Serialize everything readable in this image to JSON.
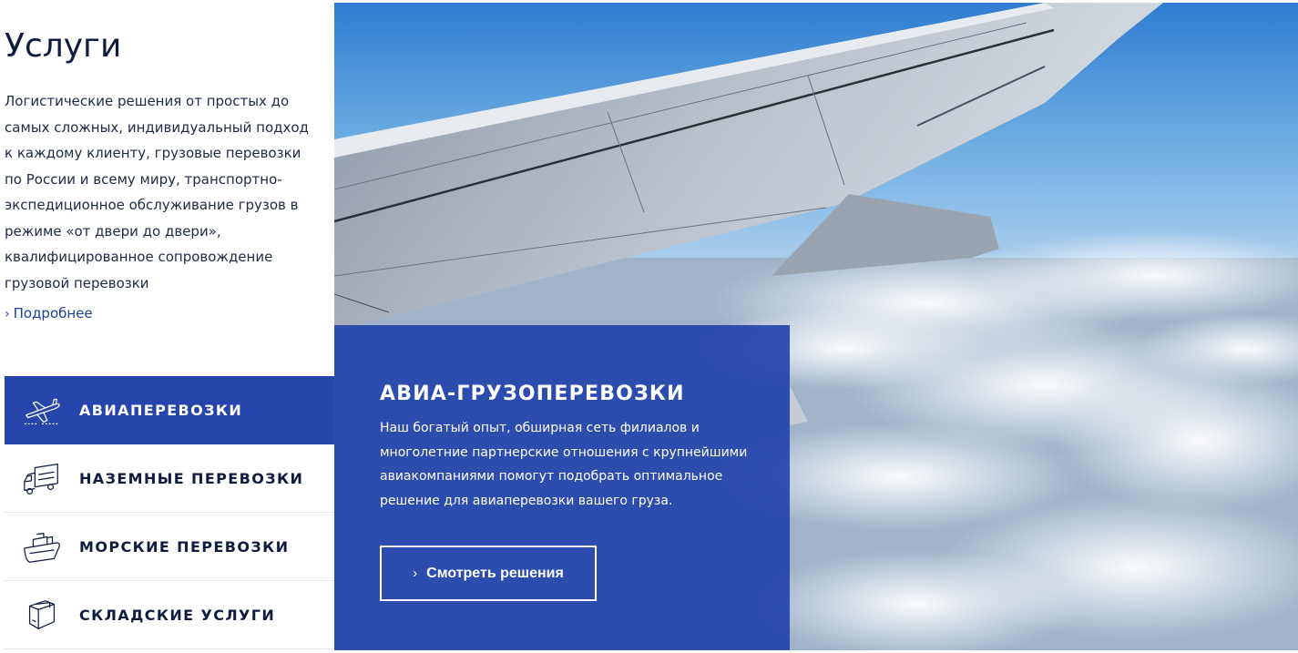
{
  "services": {
    "title": "Услуги",
    "description": "Логистические решения от простых до самых сложных, индивидуальный подход к каждому клиенту, грузовые перевозки по России и всему миру, транспортно-экспедиционное обслуживание грузов в режиме «от двери до двери», квалифицированное сопровождение грузовой перевозки",
    "more_label": "Подробнее",
    "more_icon": "chevron-right-icon"
  },
  "menu": [
    {
      "label": "АВИАПЕРЕВОЗКИ",
      "icon": "airplane-icon",
      "active": true
    },
    {
      "label": "НАЗЕМНЫЕ ПЕРЕВОЗКИ",
      "icon": "truck-icon",
      "active": false
    },
    {
      "label": "МОРСКИЕ ПЕРЕВОЗКИ",
      "icon": "ship-icon",
      "active": false
    },
    {
      "label": "СКЛАДСКИЕ УСЛУГИ",
      "icon": "box-icon",
      "active": false
    }
  ],
  "panel": {
    "title": "АВИА-ГРУЗОПЕРЕВОЗКИ",
    "text": "Наш богатый опыт, обширная сеть филиалов и многолетние партнерские отношения с крупнейшими авиакомпаниями помогут подобрать оптимальное решение для авиаперевозки вашего груза.",
    "button_label": "Смотреть решения"
  },
  "colors": {
    "accent": "#2545ac",
    "text_dark": "#0f1c3f",
    "link": "#1f3f9d",
    "sky": "#3f8bd6"
  }
}
